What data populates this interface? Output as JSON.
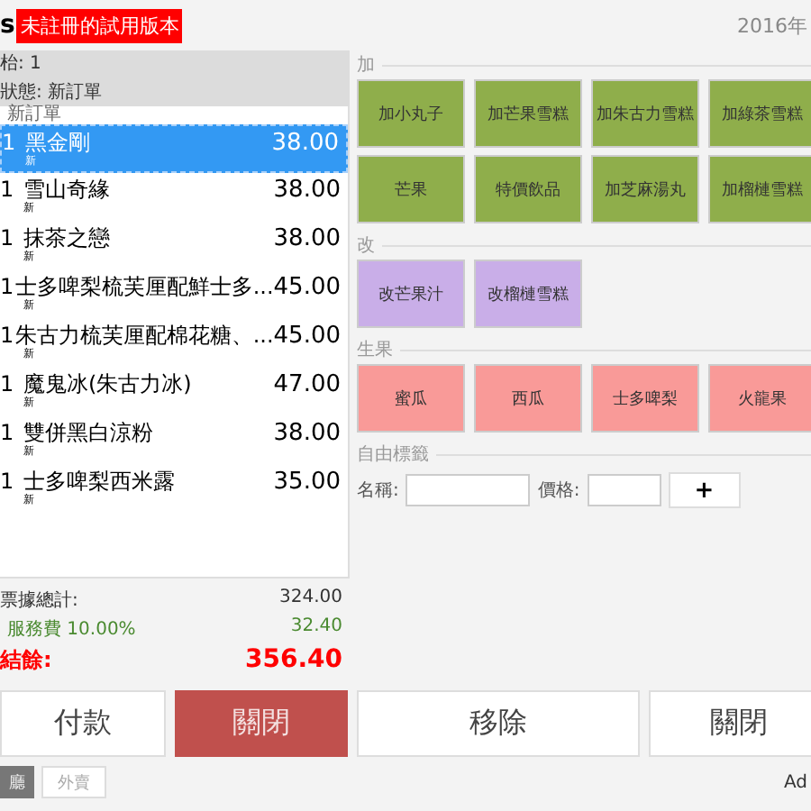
{
  "header": {
    "fragment": "s",
    "edition_badge": "未註冊的試用版本",
    "date": "2016年"
  },
  "order": {
    "table": "枱: 1",
    "status": "狀態: 新訂單",
    "group_label": "新訂單",
    "items": [
      {
        "qty": "1",
        "name": "黑金剛",
        "price": "38.00",
        "tag": "新",
        "selected": true
      },
      {
        "qty": "1",
        "name": "雪山奇緣",
        "price": "38.00",
        "tag": "新",
        "selected": false
      },
      {
        "qty": "1",
        "name": "抹茶之戀",
        "price": "38.00",
        "tag": "新",
        "selected": false
      },
      {
        "qty": "1",
        "name": "士多啤梨梳芙厘配鮮士多...",
        "price": "45.00",
        "tag": "新",
        "selected": false
      },
      {
        "qty": "1",
        "name": "朱古力梳芙厘配棉花糖、...",
        "price": "45.00",
        "tag": "新",
        "selected": false
      },
      {
        "qty": "1",
        "name": "魔鬼冰(朱古力冰)",
        "price": "47.00",
        "tag": "新",
        "selected": false
      },
      {
        "qty": "1",
        "name": "雙併黑白涼粉",
        "price": "38.00",
        "tag": "新",
        "selected": false
      },
      {
        "qty": "1",
        "name": "士多啤梨西米露",
        "price": "35.00",
        "tag": "新",
        "selected": false
      }
    ]
  },
  "totals": {
    "subtotal_label": "票據總計:",
    "subtotal": "324.00",
    "service_label": "服務費 10.00%",
    "service": "32.40",
    "balance_label": "結餘:",
    "balance": "356.40"
  },
  "actions": [
    {
      "label": "付款",
      "kind": "plain"
    },
    {
      "label": "關閉",
      "kind": "danger"
    },
    {
      "label": "移除",
      "kind": "plain"
    },
    {
      "label": "關閉",
      "kind": "plain"
    }
  ],
  "categories": [
    {
      "title": "加",
      "color": "#8fae4b",
      "items": [
        "加小丸子",
        "加芒果雪糕",
        "加朱古力雪糕",
        "加綠茶雪糕",
        "芒果",
        "特價飲品",
        "加芝麻湯丸",
        "加榴槤雪糕"
      ]
    },
    {
      "title": "改",
      "color": "#c9aee8",
      "items": [
        "改芒果汁",
        "改榴槤雪糕"
      ]
    },
    {
      "title": "生果",
      "color": "#f99a98",
      "items": [
        "蜜瓜",
        "西瓜",
        "士多啤梨",
        "火龍果"
      ]
    }
  ],
  "free_label": {
    "title": "自由標籤",
    "name_label": "名稱:",
    "price_label": "價格:",
    "add_button": "+"
  },
  "tabs": [
    {
      "label": "廳",
      "selected": true
    },
    {
      "label": "外賣",
      "selected": false
    }
  ],
  "footer_text": "Ad"
}
